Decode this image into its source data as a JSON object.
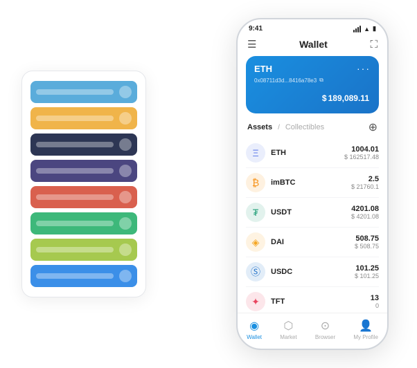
{
  "scene": {
    "card_stack": {
      "cards": [
        {
          "color": "#5aacdb",
          "icon": "◆"
        },
        {
          "color": "#f0b44a",
          "icon": "◆"
        },
        {
          "color": "#2d3654",
          "icon": "◆"
        },
        {
          "color": "#4b4680",
          "icon": "◆"
        },
        {
          "color": "#d9604e",
          "icon": "◆"
        },
        {
          "color": "#3db87a",
          "icon": "◆"
        },
        {
          "color": "#a6c94f",
          "icon": "◆"
        },
        {
          "color": "#3b8fe8",
          "icon": "◆"
        }
      ]
    },
    "phone": {
      "status_bar": {
        "time": "9:41",
        "signal": "●●●",
        "wifi": "▲",
        "battery": "▮"
      },
      "header": {
        "menu_icon": "☰",
        "title": "Wallet",
        "expand_icon": "⛶"
      },
      "eth_card": {
        "label": "ETH",
        "dots": "···",
        "address": "0x08711d3d...8416a78e3",
        "copy_icon": "⧉",
        "amount_symbol": "$",
        "amount": "189,089.11"
      },
      "assets": {
        "active_tab": "Assets",
        "separator": "/",
        "inactive_tab": "Collectibles",
        "add_icon": "⊕",
        "items": [
          {
            "name": "ETH",
            "icon_color": "#627eea",
            "icon_char": "Ξ",
            "amount": "1004.01",
            "usd": "$ 162517.48"
          },
          {
            "name": "imBTC",
            "icon_color": "#f7931a",
            "icon_char": "₿",
            "amount": "2.5",
            "usd": "$ 21760.1"
          },
          {
            "name": "USDT",
            "icon_color": "#26a17b",
            "icon_char": "₮",
            "amount": "4201.08",
            "usd": "$ 4201.08"
          },
          {
            "name": "DAI",
            "icon_color": "#f5a623",
            "icon_char": "◈",
            "amount": "508.75",
            "usd": "$ 508.75"
          },
          {
            "name": "USDC",
            "icon_color": "#2775ca",
            "icon_char": "Ⓢ",
            "amount": "101.25",
            "usd": "$ 101.25"
          },
          {
            "name": "TFT",
            "icon_color": "#e94560",
            "icon_char": "✦",
            "amount": "13",
            "usd": "0"
          }
        ]
      },
      "nav": {
        "items": [
          {
            "icon": "◉",
            "label": "Wallet",
            "active": true
          },
          {
            "icon": "⬡",
            "label": "Market",
            "active": false
          },
          {
            "icon": "⊙",
            "label": "Browser",
            "active": false
          },
          {
            "icon": "👤",
            "label": "My Profile",
            "active": false
          }
        ]
      }
    }
  }
}
